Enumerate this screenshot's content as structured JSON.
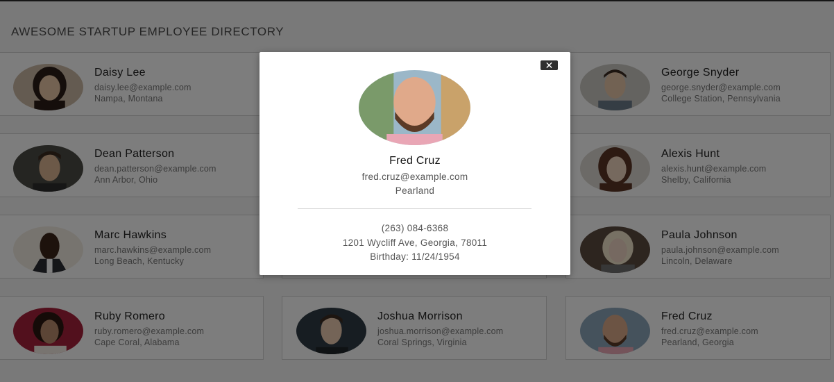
{
  "header": {
    "title": "AWESOME STARTUP EMPLOYEE DIRECTORY"
  },
  "employees": [
    {
      "name": "Daisy Lee",
      "email": "daisy.lee@example.com",
      "location": "Nampa, Montana"
    },
    {
      "name": "",
      "email": "",
      "location": ""
    },
    {
      "name": "George Snyder",
      "email": "george.snyder@example.com",
      "location": "College Station, Pennsylvania"
    },
    {
      "name": "Dean Patterson",
      "email": "dean.patterson@example.com",
      "location": "Ann Arbor, Ohio"
    },
    {
      "name": "",
      "email": "",
      "location": ""
    },
    {
      "name": "Alexis Hunt",
      "email": "alexis.hunt@example.com",
      "location": "Shelby, California"
    },
    {
      "name": "Marc Hawkins",
      "email": "marc.hawkins@example.com",
      "location": "Long Beach, Kentucky"
    },
    {
      "name": "",
      "email": "",
      "location": ""
    },
    {
      "name": "Paula Johnson",
      "email": "paula.johnson@example.com",
      "location": "Lincoln, Delaware"
    },
    {
      "name": "Ruby Romero",
      "email": "ruby.romero@example.com",
      "location": "Cape Coral, Alabama"
    },
    {
      "name": "Joshua Morrison",
      "email": "joshua.morrison@example.com",
      "location": "Coral Springs, Virginia"
    },
    {
      "name": "Fred Cruz",
      "email": "fred.cruz@example.com",
      "location": "Pearland, Georgia"
    }
  ],
  "modal": {
    "close_label": "✕",
    "name": "Fred Cruz",
    "email": "fred.cruz@example.com",
    "city": "Pearland",
    "phone": "(263) 084-6368",
    "address": "1201 Wycliff Ave, Georgia, 78011",
    "birthday": "Birthday: 11/24/1954"
  }
}
